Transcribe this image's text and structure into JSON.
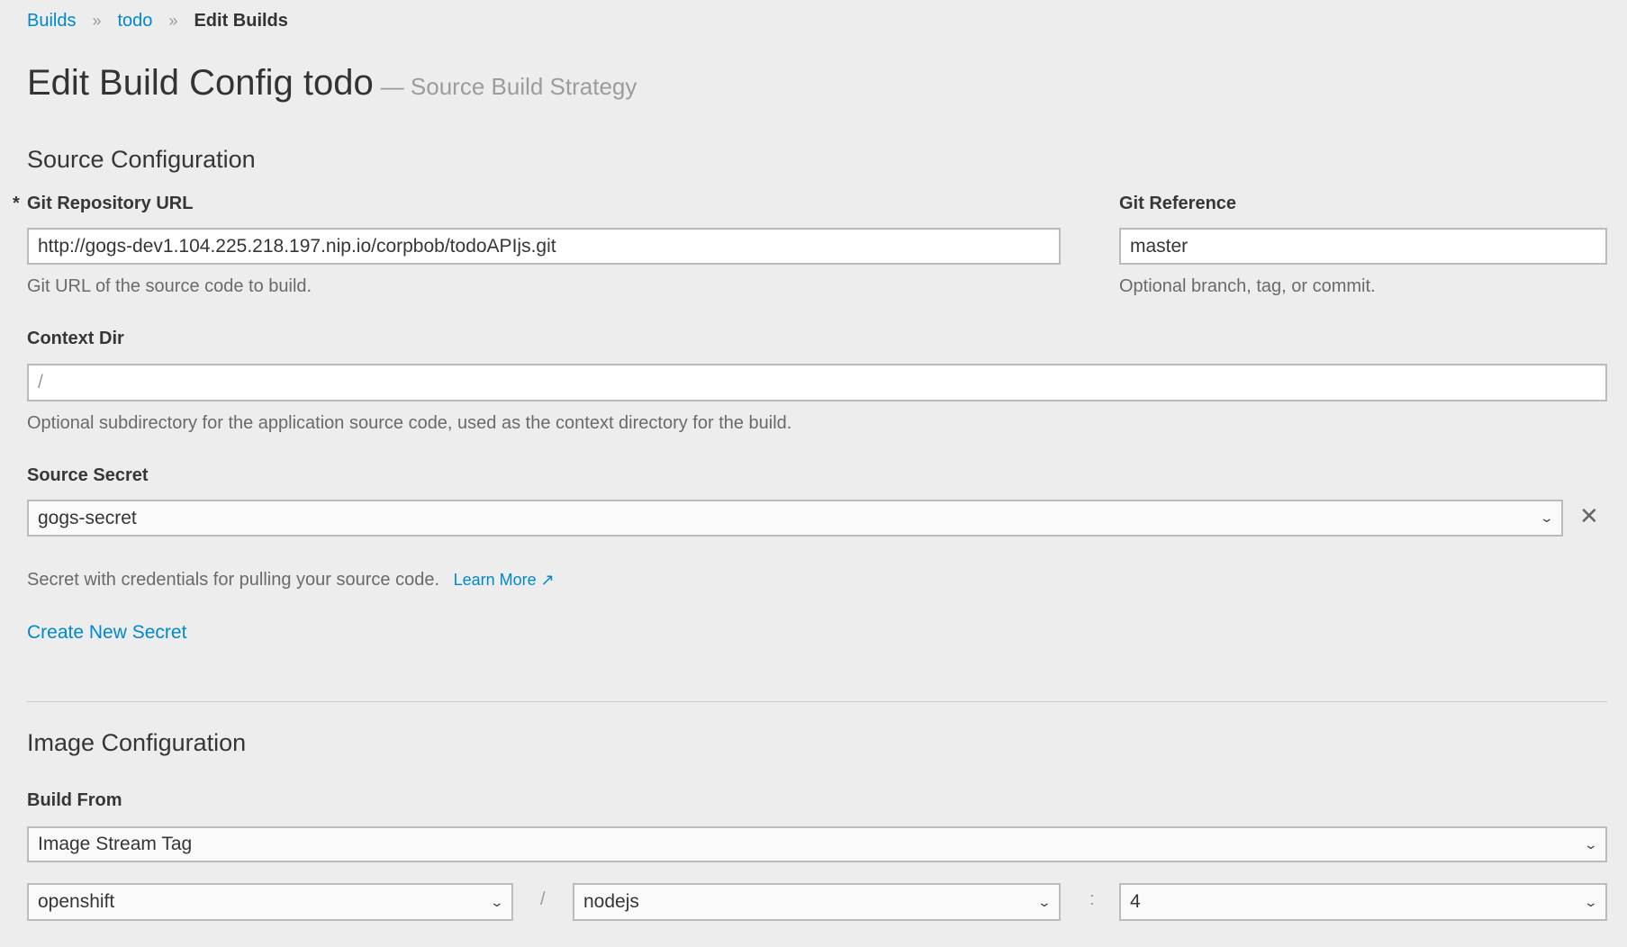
{
  "breadcrumb": {
    "items": [
      {
        "label": "Builds"
      },
      {
        "label": "todo"
      }
    ],
    "current": "Edit Builds",
    "separator": "»"
  },
  "header": {
    "title": "Edit Build Config todo",
    "subtitle": "— Source Build Strategy"
  },
  "source": {
    "heading": "Source Configuration",
    "git_url": {
      "required_marker": "*",
      "label": "Git Repository URL",
      "value": "http://gogs-dev1.104.225.218.197.nip.io/corpbob/todoAPIjs.git",
      "help": "Git URL of the source code to build."
    },
    "git_ref": {
      "label": "Git Reference",
      "value": "master",
      "help": "Optional branch, tag, or commit."
    },
    "context_dir": {
      "label": "Context Dir",
      "placeholder": "/",
      "help": "Optional subdirectory for the application source code, used as the context directory for the build."
    },
    "secret": {
      "label": "Source Secret",
      "value": "gogs-secret",
      "help": "Secret with credentials for pulling your source code.",
      "learn_more": "Learn More",
      "create_label": "Create New Secret",
      "clear_icon": "✕"
    }
  },
  "image": {
    "heading": "Image Configuration",
    "build_from": {
      "label": "Build From",
      "value": "Image Stream Tag"
    },
    "namespace": "openshift",
    "slash": "/",
    "stream": "nodejs",
    "colon": ":",
    "tag": "4"
  },
  "colors": {
    "link": "#0088ce",
    "background": "#ededed"
  }
}
